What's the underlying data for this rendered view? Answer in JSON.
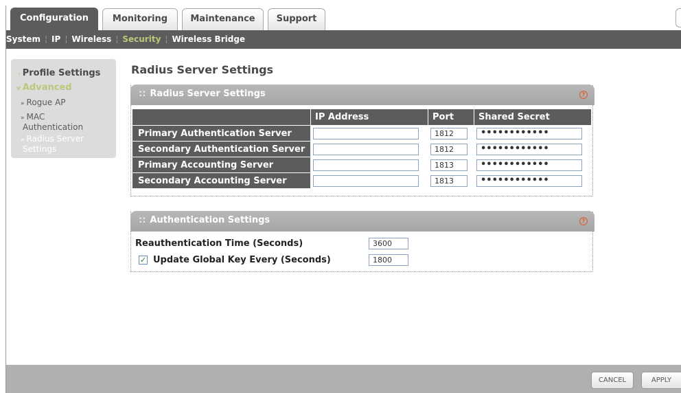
{
  "tabs": [
    {
      "label": "Configuration",
      "active": true
    },
    {
      "label": "Monitoring",
      "active": false
    },
    {
      "label": "Maintenance",
      "active": false
    },
    {
      "label": "Support",
      "active": false
    }
  ],
  "subnav": [
    {
      "label": "System"
    },
    {
      "label": "IP"
    },
    {
      "label": "Wireless"
    },
    {
      "label": "Security",
      "active": true
    },
    {
      "label": "Wireless Bridge"
    }
  ],
  "sidebar": {
    "profile_settings": "Profile Settings",
    "advanced": "Advanced",
    "rogue_ap": "Rogue AP",
    "mac_auth_1": "MAC",
    "mac_auth_2": "Authentication",
    "radius_1": "Radius Server",
    "radius_2": "Settings"
  },
  "page_title": "Radius Server Settings",
  "radius_panel": {
    "title": "Radius Server Settings",
    "headers": {
      "ip": "IP Address",
      "port": "Port",
      "secret": "Shared Secret"
    },
    "rows": [
      {
        "label": "Primary Authentication Server",
        "ip": "",
        "port": "1812",
        "secret": "••••••••••••"
      },
      {
        "label": "Secondary Authentication Server",
        "ip": "",
        "port": "1812",
        "secret": "••••••••••••"
      },
      {
        "label": "Primary Accounting Server",
        "ip": "",
        "port": "1813",
        "secret": "••••••••••••"
      },
      {
        "label": "Secondary Accounting Server",
        "ip": "",
        "port": "1813",
        "secret": "••••••••••••"
      }
    ]
  },
  "auth_panel": {
    "title": "Authentication Settings",
    "reauth_label": "Reauthentication Time (Seconds)",
    "reauth_value": "3600",
    "update_key_label": "Update Global Key Every (Seconds)",
    "update_key_checked": true,
    "update_key_value": "1800"
  },
  "footer": {
    "cancel": "CANCEL",
    "apply": "APPLY"
  },
  "colors": {
    "nav_bg": "#5c5c5c",
    "active_green": "#b8c97a",
    "panel_head": "#adadad",
    "help_orange": "#e05a2a"
  }
}
